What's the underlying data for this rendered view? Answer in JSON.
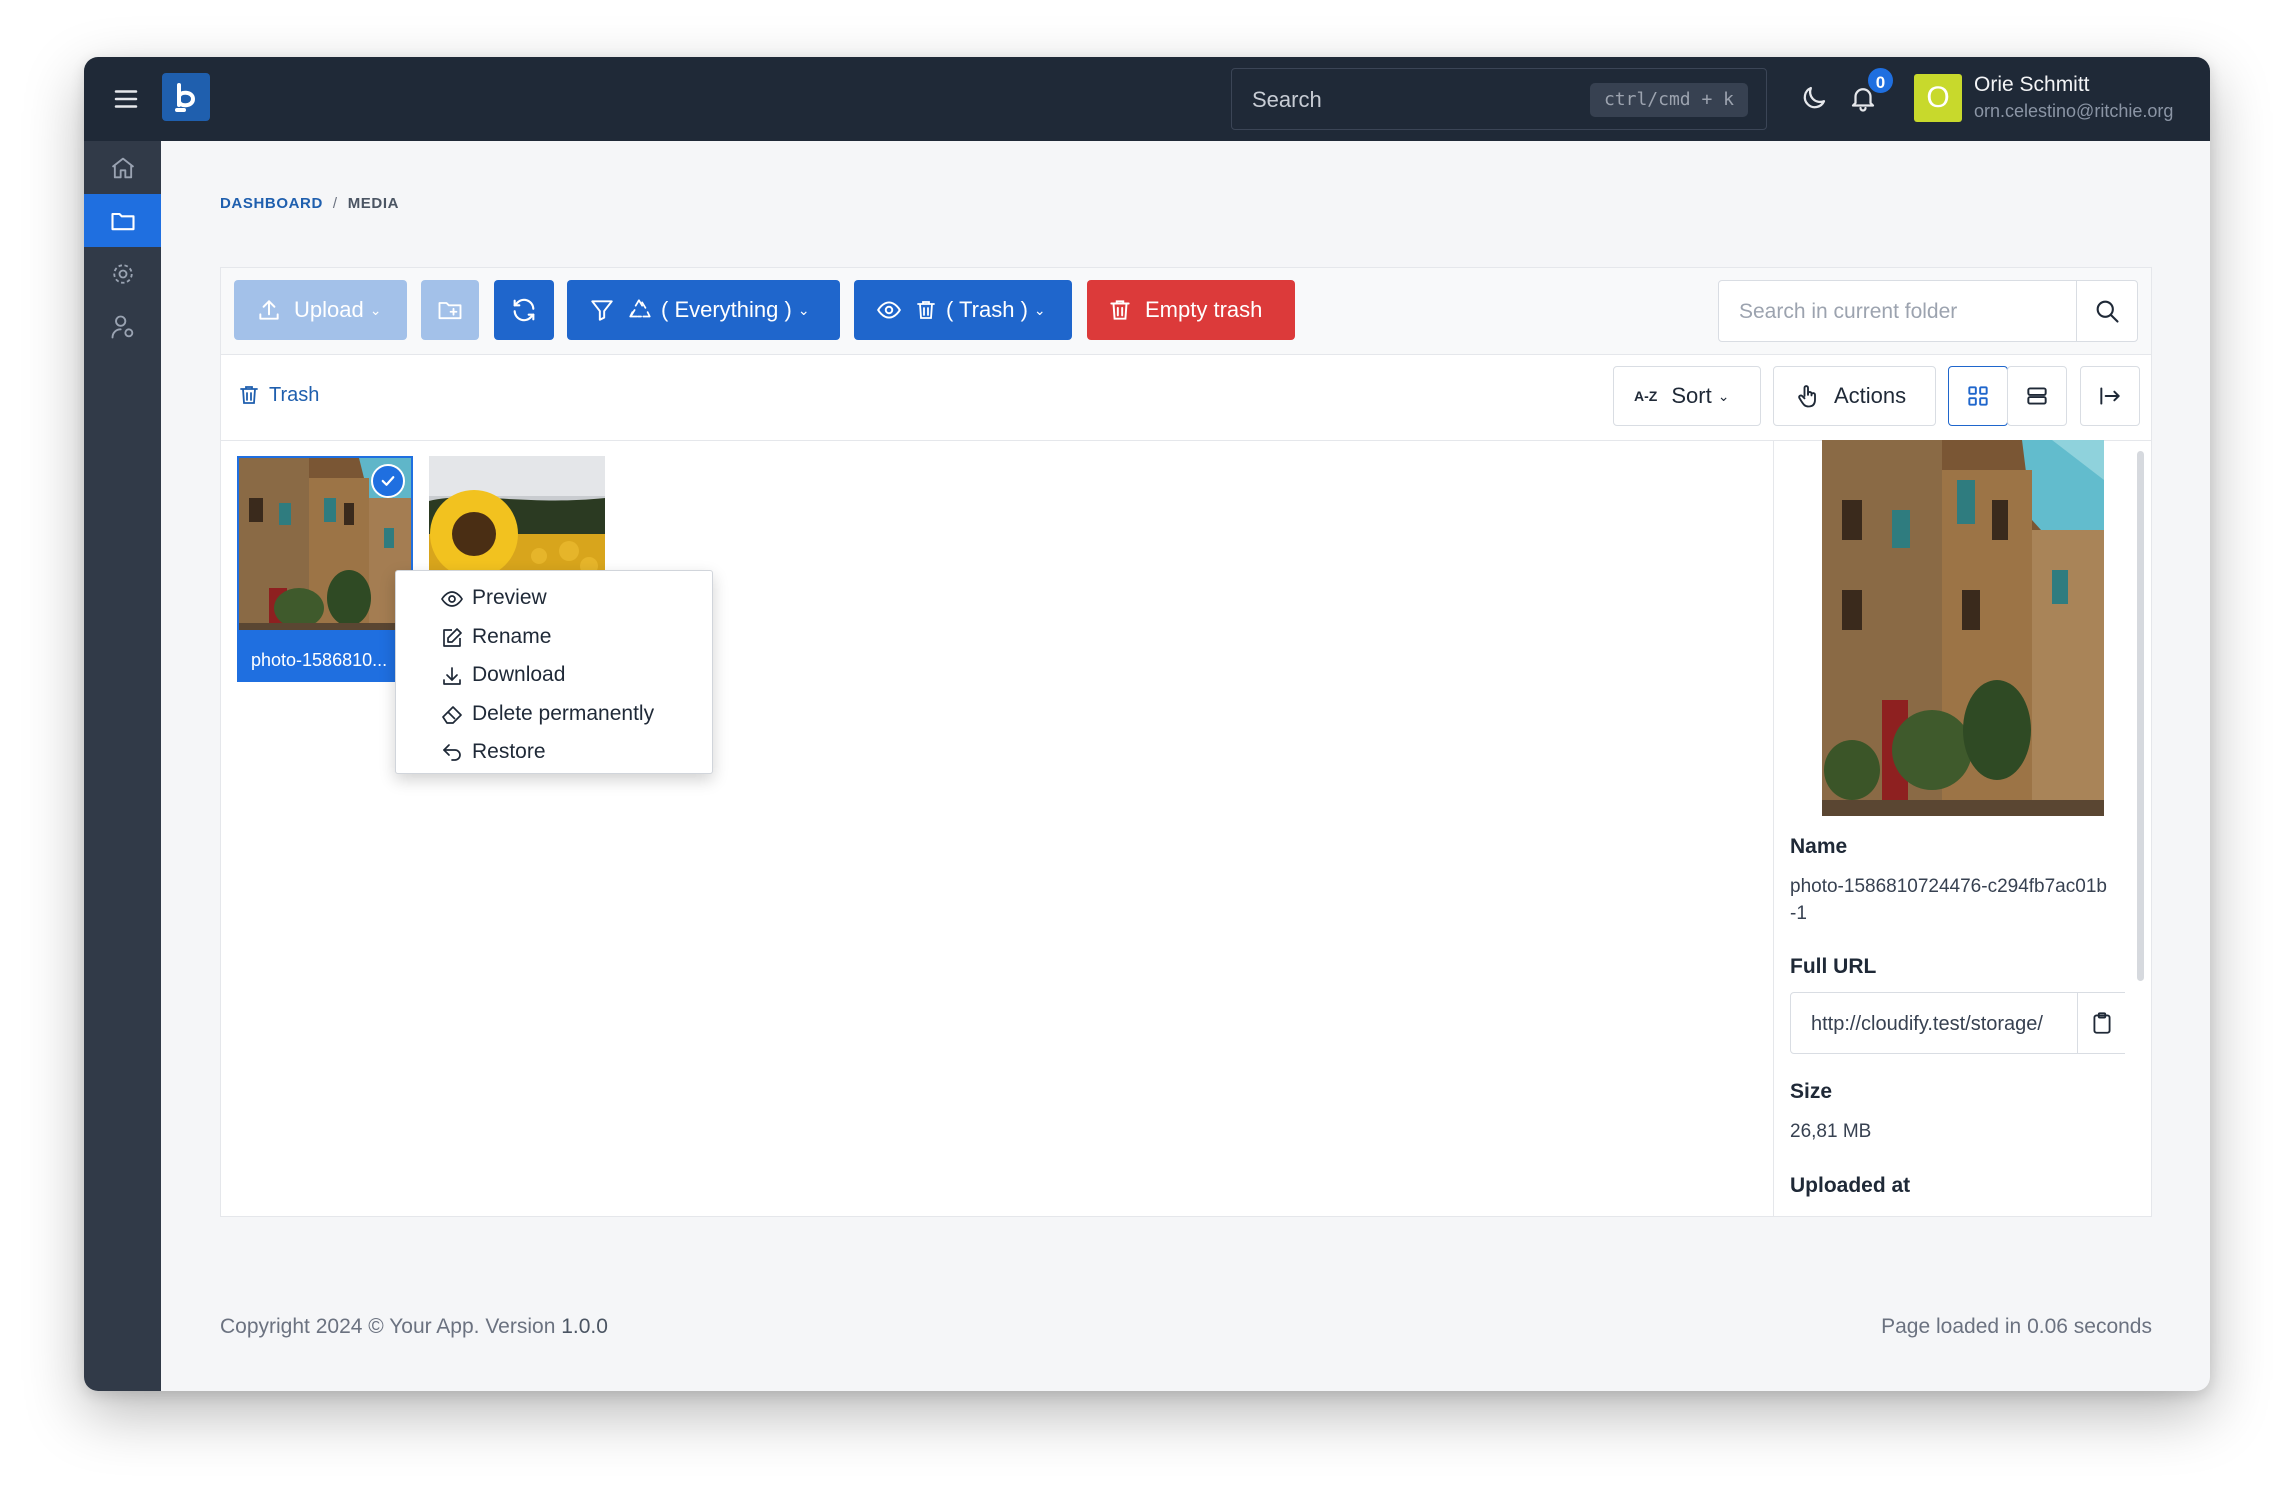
{
  "topbar": {
    "search_placeholder": "Search",
    "search_shortcut": "ctrl/cmd + k",
    "notification_count": "0",
    "user": {
      "initial": "O",
      "name": "Orie Schmitt",
      "email": "orn.celestino@ritchie.org"
    }
  },
  "breadcrumb": {
    "dashboard": "DASHBOARD",
    "separator": "/",
    "current": "MEDIA"
  },
  "toolbar": {
    "upload_label": "Upload",
    "filter_label": "( Everything )",
    "view_label": "( Trash )",
    "empty_trash_label": "Empty trash",
    "folder_search_placeholder": "Search in current folder"
  },
  "subbar": {
    "crumb_label": "Trash",
    "sort_prefix": "A-Z",
    "sort_label": "Sort",
    "actions_label": "Actions"
  },
  "files": [
    {
      "name": "photo-1586810..."
    },
    {
      "name": ""
    }
  ],
  "context_menu": {
    "items": [
      {
        "label": "Preview",
        "icon": "eye-icon"
      },
      {
        "label": "Rename",
        "icon": "edit-icon"
      },
      {
        "label": "Download",
        "icon": "download-icon"
      },
      {
        "label": "Delete permanently",
        "icon": "eraser-icon"
      },
      {
        "label": "Restore",
        "icon": "undo-icon"
      }
    ]
  },
  "details": {
    "name_label": "Name",
    "name_value": "photo-1586810724476-c294fb7ac01b-1",
    "url_label": "Full URL",
    "url_value": "http://cloudify.test/storage/",
    "size_label": "Size",
    "size_value": "26,81 MB",
    "uploaded_label": "Uploaded at"
  },
  "footer": {
    "copyright": "Copyright 2024 © Your App. Version ",
    "version": "1.0.0",
    "load_time": "Page loaded in 0.06 seconds"
  },
  "colors": {
    "topbar": "#1f2937",
    "sidebar": "#313a48",
    "primary": "#1f66cc",
    "danger": "#dc3a3a",
    "avatar": "#c8d92c"
  }
}
